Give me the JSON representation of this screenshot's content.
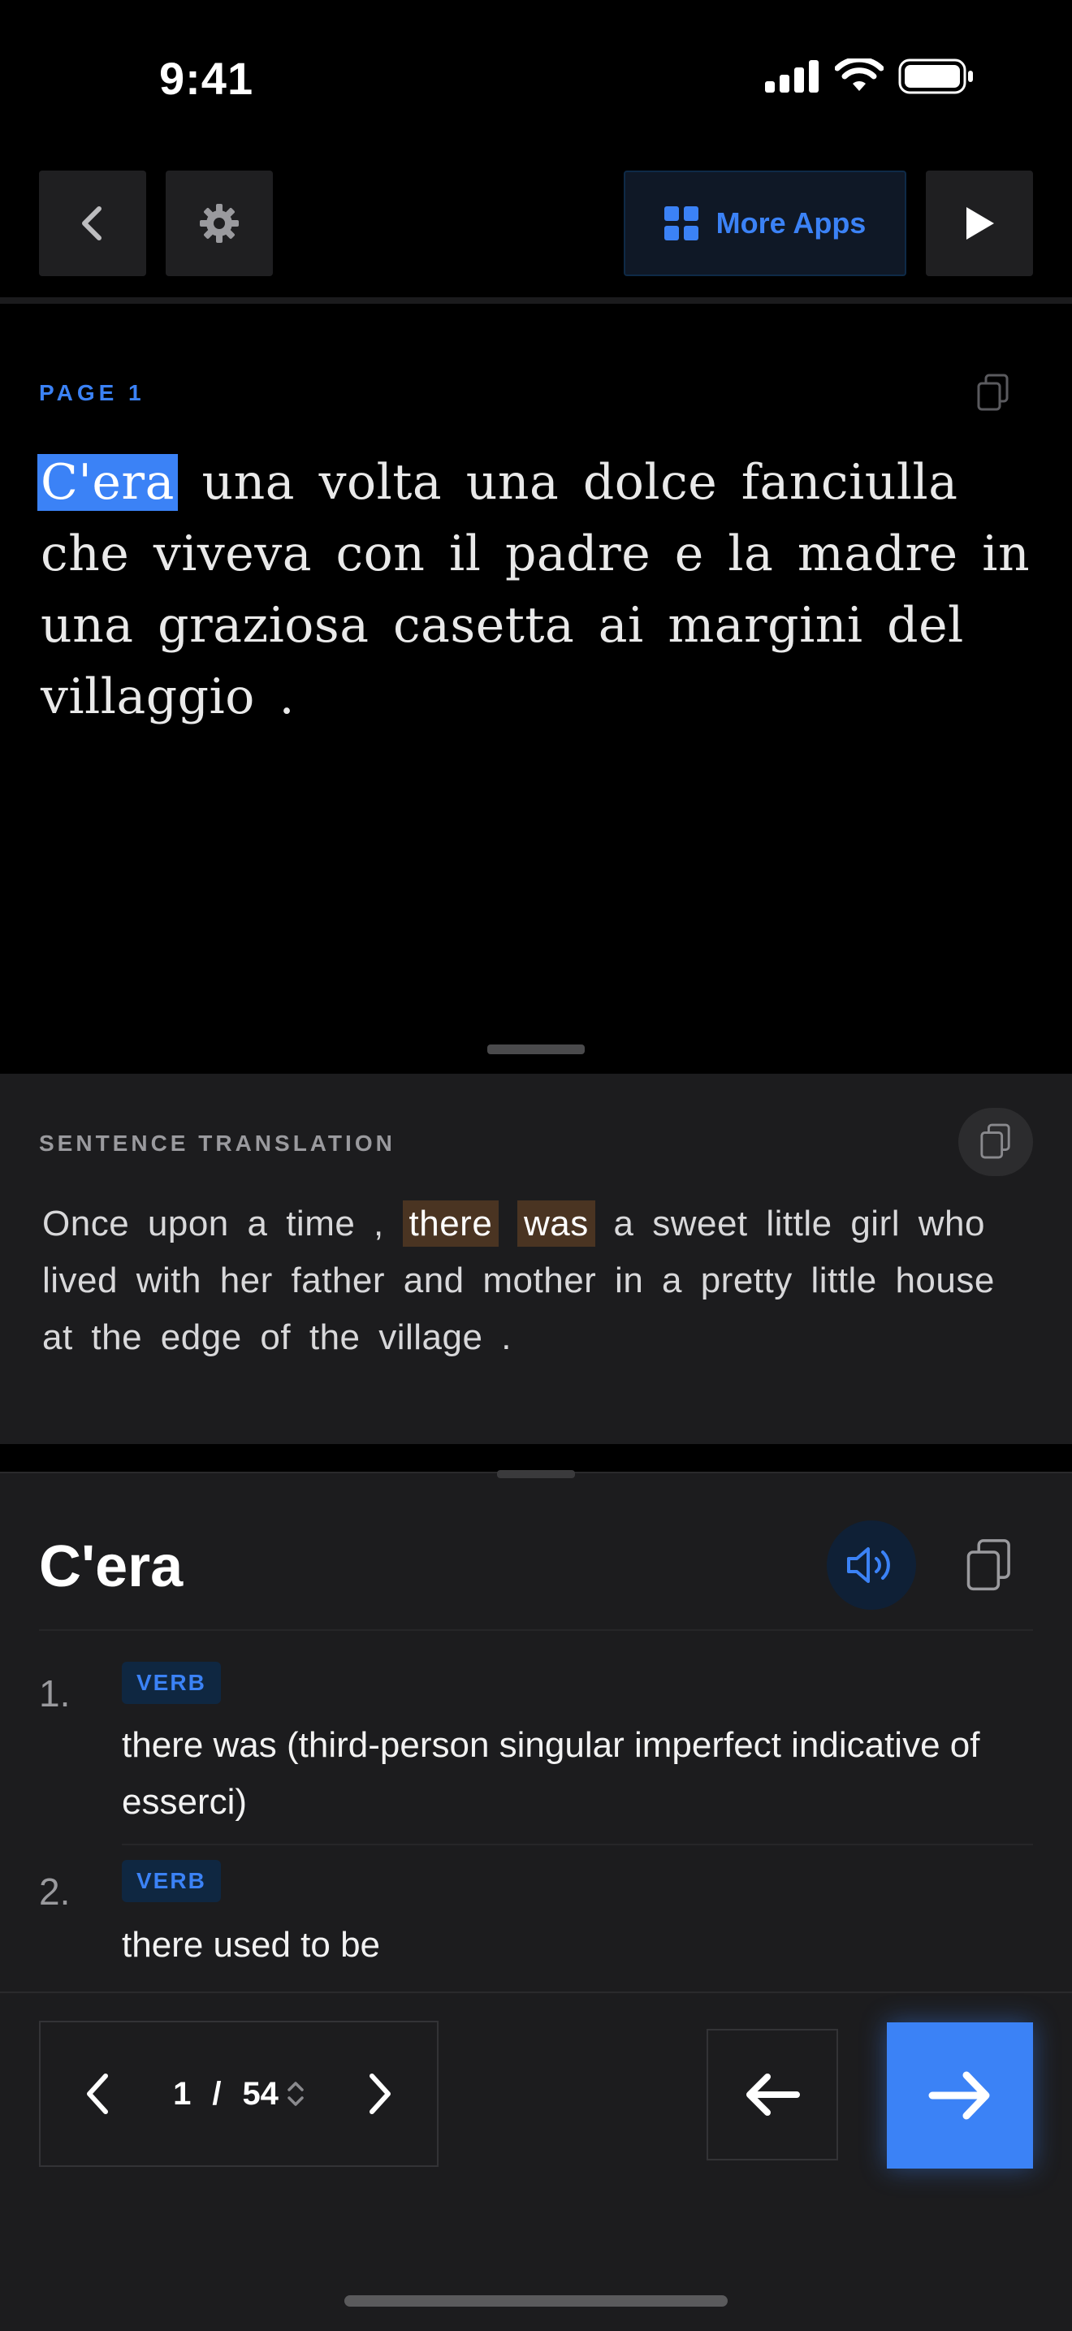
{
  "status_bar": {
    "time": "9:41"
  },
  "toolbar": {
    "more_apps_label": "More Apps"
  },
  "reader": {
    "page_label": "PAGE 1",
    "highlighted_word": "C'era",
    "text_rest": " una volta una dolce fanciulla che viveva con il padre e la madre in una graziosa casetta ai margini del villaggio ."
  },
  "translation": {
    "section_label": "SENTENCE TRANSLATION",
    "text_before": "Once upon a time , ",
    "highlight_1": "there",
    "highlight_2": "was",
    "text_after": " a sweet little girl who lived with her father and mother in a pretty little house at the edge of the village ."
  },
  "dictionary": {
    "word": "C'era",
    "definitions": [
      {
        "number": "1.",
        "pos": "VERB",
        "text": "there was (third-person singular imperfect indicative of esserci)"
      },
      {
        "number": "2.",
        "pos": "VERB",
        "text": "there used to be"
      }
    ]
  },
  "pager": {
    "current": "1",
    "separator": "/",
    "total": "54"
  },
  "colors": {
    "accent": "#3b82f6",
    "highlight_brown": "#4a3422",
    "panel": "#1c1c1e"
  },
  "icons": [
    "signal-icon",
    "wifi-icon",
    "battery-icon",
    "back-chevron-icon",
    "gear-icon",
    "grid-icon",
    "play-icon",
    "copy-icon",
    "speaker-icon",
    "chevron-left-icon",
    "chevron-right-icon",
    "updown-icon",
    "arrow-left-icon",
    "arrow-right-icon"
  ]
}
